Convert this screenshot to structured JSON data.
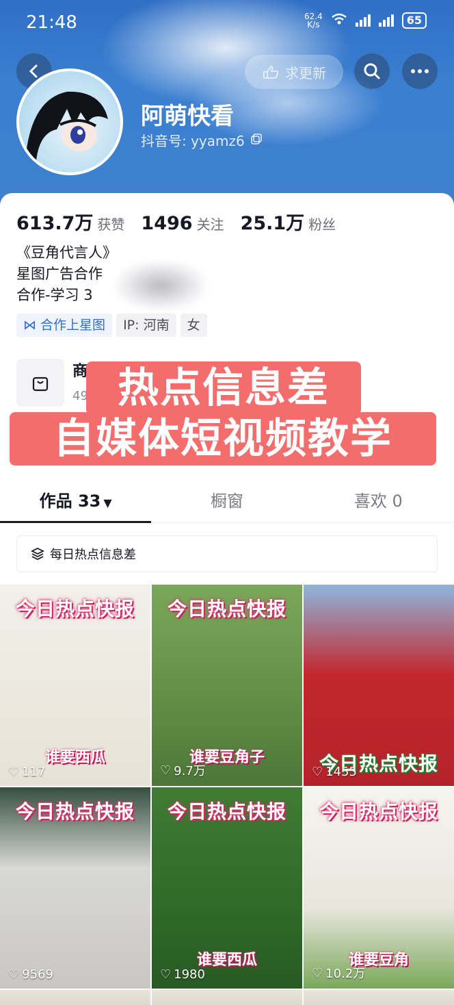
{
  "status_bar": {
    "time": "21:48",
    "net_speed_value": "62.4",
    "net_speed_unit": "K/s",
    "network": "6",
    "battery": "65"
  },
  "header": {
    "update_label": "求更新"
  },
  "profile": {
    "nickname": "阿萌快看",
    "douyin_id": "抖音号: yyamz6"
  },
  "stats": [
    {
      "value": "613.7万",
      "label": "获赞"
    },
    {
      "value": "1496",
      "label": "关注"
    },
    {
      "value": "25.1万",
      "label": "粉丝"
    }
  ],
  "bio": {
    "line1": "《豆角代言人》",
    "line2": "星图广告合作",
    "line3": "合作-学习 3"
  },
  "tags": {
    "star": "合作上星图",
    "ip": "IP: 河南",
    "gender": "女"
  },
  "shop": {
    "title": "商",
    "sub": "49"
  },
  "overlay": {
    "line1": "热点信息差",
    "line2": "自媒体短视频教学"
  },
  "tabs": {
    "works": "作品 33",
    "window": "橱窗",
    "likes": "喜欢 0"
  },
  "collection": {
    "label": "每日热点信息差"
  },
  "videos": [
    {
      "banner": "今日热点快报",
      "caption": "谁要西瓜",
      "likes": "117"
    },
    {
      "banner": "今日热点快报",
      "caption": "谁要豆角子",
      "likes": "9.7万"
    },
    {
      "banner": "今日热点快报",
      "caption": "",
      "likes": "1455"
    },
    {
      "banner": "今日热点快报",
      "caption": "",
      "likes": "9569"
    },
    {
      "banner": "今日热点快报",
      "caption": "谁要西瓜",
      "likes": "1980"
    },
    {
      "banner": "今日热点快报",
      "caption": "谁要豆角",
      "likes": "10.2万"
    }
  ],
  "colors": {
    "header_blue": "#3b7fd1",
    "overlay_red": "#f46d6d",
    "star_blue": "#2f6fd6"
  }
}
